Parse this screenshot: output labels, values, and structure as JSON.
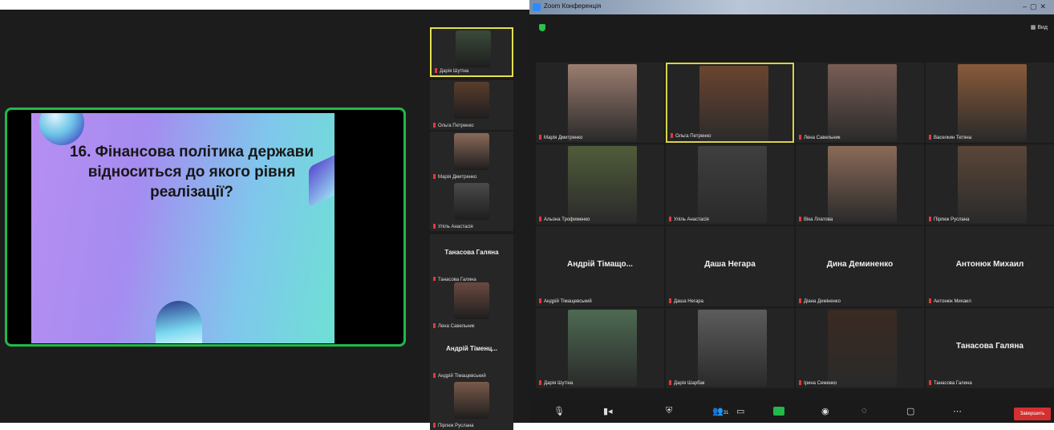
{
  "slide": {
    "title": "16. Фінансова політика держави\nвідноситься до якого рівня\nреалізації?"
  },
  "thumbnails": [
    {
      "name": "Дарія Шутіна",
      "has_video": true,
      "color": "#3b4a3a",
      "active": true
    },
    {
      "name": "Ольга Петренко",
      "has_video": true,
      "color": "#5a3d2c"
    },
    {
      "name": "Марія Дмитренко",
      "has_video": true,
      "color": "#8a6a5a"
    },
    {
      "name": "Уліль Анастасія",
      "has_video": true,
      "color": "#4a4a4a"
    },
    {
      "name": "Танасова Галина",
      "has_video": false,
      "big": "Танасова Галяна"
    },
    {
      "name": "Лена Савельник",
      "has_video": true,
      "color": "#6a4a40"
    },
    {
      "name": "Андрій Тімащевський",
      "has_video": false,
      "big": "Андрій Тіменц..."
    },
    {
      "name": "Пірлюк Руслана",
      "has_video": true,
      "color": "#7a5a4a"
    }
  ],
  "window": {
    "title": "Zoom Конференція",
    "view_label": "Вид"
  },
  "grid": [
    {
      "name": "Марія Дмитренко",
      "has_video": true,
      "color": "#9c7d70"
    },
    {
      "name": "Ольга Петренко",
      "has_video": true,
      "color": "#6b4430",
      "speaking": true
    },
    {
      "name": "Лена Савельник",
      "has_video": true,
      "color": "#7a5d55"
    },
    {
      "name": "Васелкин Тетяна",
      "has_video": true,
      "color": "#8a5a3a"
    },
    {
      "name": "Альона Трофименко",
      "has_video": true,
      "color": "#4f5c3a"
    },
    {
      "name": "Уліль Анастасія",
      "has_video": true,
      "color": "#3f3f3f"
    },
    {
      "name": "Віка Ллатова",
      "has_video": true,
      "color": "#8a6a58"
    },
    {
      "name": "Пірлюк Руслана",
      "has_video": true,
      "color": "#5a4638"
    },
    {
      "name": "Андрій Тімащевський",
      "has_video": false,
      "big": "Андрій Тімащо..."
    },
    {
      "name": "Даша Негара",
      "has_video": false,
      "big": "Даша Негара"
    },
    {
      "name": "Діана Деміненко",
      "has_video": false,
      "big": "Дина Деминенко"
    },
    {
      "name": "Антонюк Михаил",
      "has_video": false,
      "big": "Антонюк Михаил"
    },
    {
      "name": "Дарія Шутіна",
      "has_video": true,
      "color": "#4d6a52"
    },
    {
      "name": "Дарія Шарбак",
      "has_video": true,
      "color": "#5c5c5c"
    },
    {
      "name": "Ірина Семенко",
      "has_video": true,
      "color": "#3a2a22"
    },
    {
      "name": "Танасова Галина",
      "has_video": false,
      "big": "Танасова Галяна"
    }
  ],
  "toolbar": {
    "participants_count": "31",
    "end_label": "Завершить"
  }
}
